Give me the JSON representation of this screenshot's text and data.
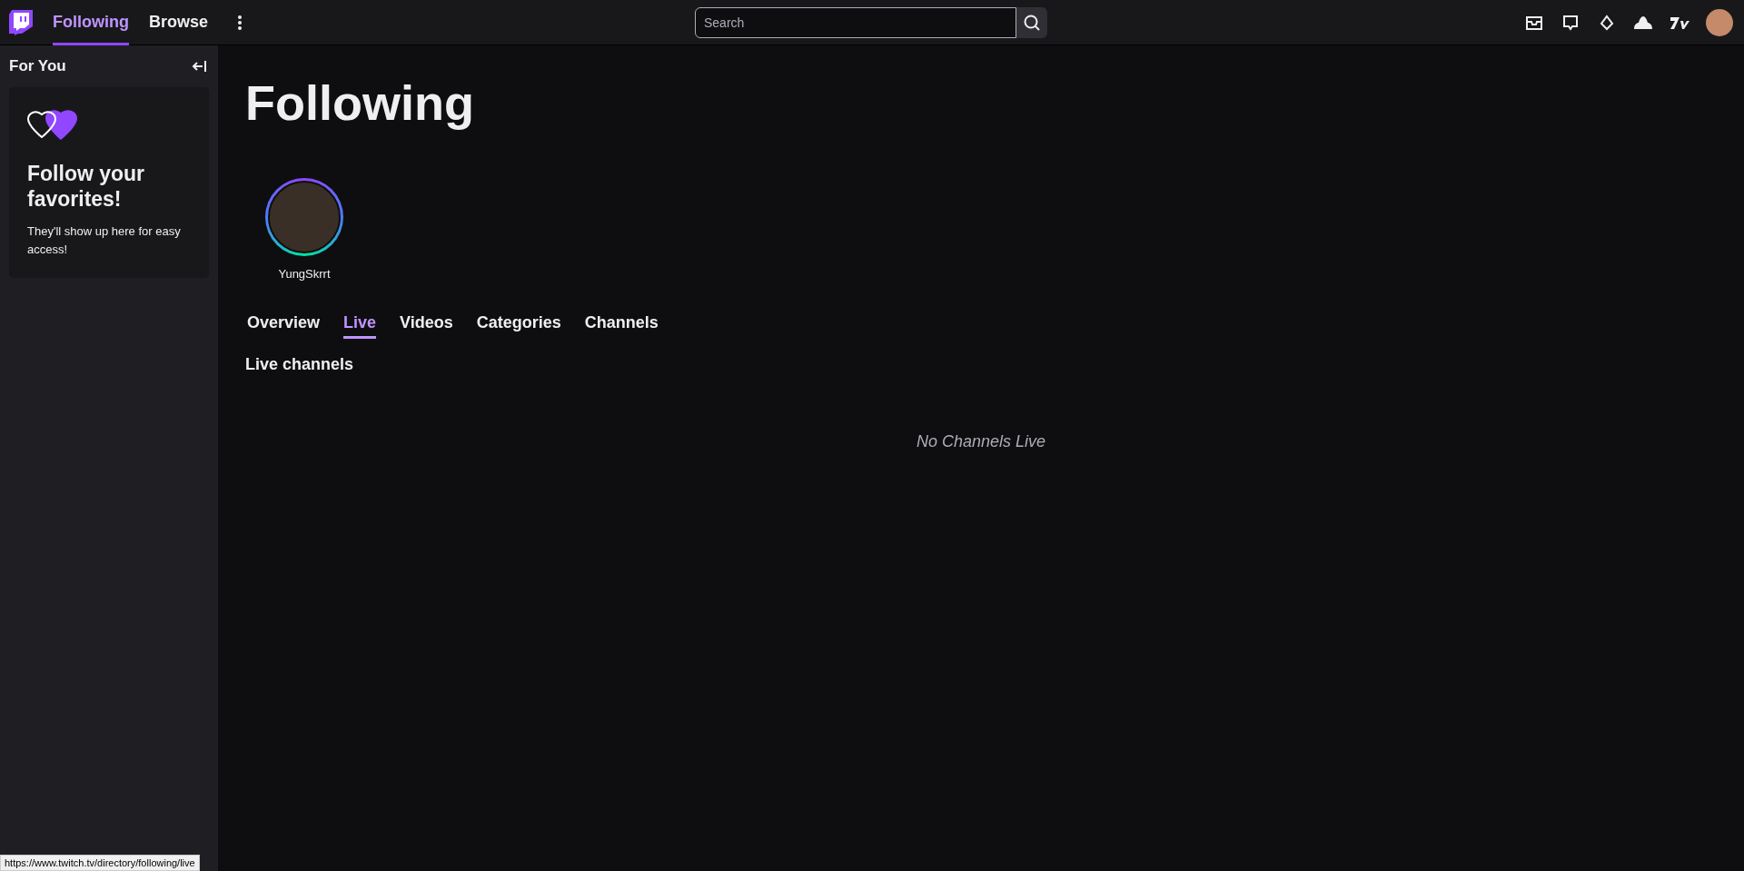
{
  "top_nav": [
    {
      "label": "Following",
      "selected": true
    },
    {
      "label": "Browse",
      "selected": false
    }
  ],
  "search": {
    "placeholder": "Search"
  },
  "sidebar": {
    "title": "For You",
    "promo": {
      "heading": "Follow your favorites!",
      "body": "They'll show up here for easy access!"
    }
  },
  "page_title": "Following",
  "followed_channels": [
    {
      "name": "YungSkrrt"
    }
  ],
  "tabs": [
    {
      "label": "Overview",
      "selected": false
    },
    {
      "label": "Live",
      "selected": true
    },
    {
      "label": "Videos",
      "selected": false
    },
    {
      "label": "Categories",
      "selected": false
    },
    {
      "label": "Channels",
      "selected": false
    }
  ],
  "section_title": "Live channels",
  "empty_message": "No Channels Live",
  "status_bar": {
    "url": "https://www.twitch.tv/directory/following/live"
  }
}
